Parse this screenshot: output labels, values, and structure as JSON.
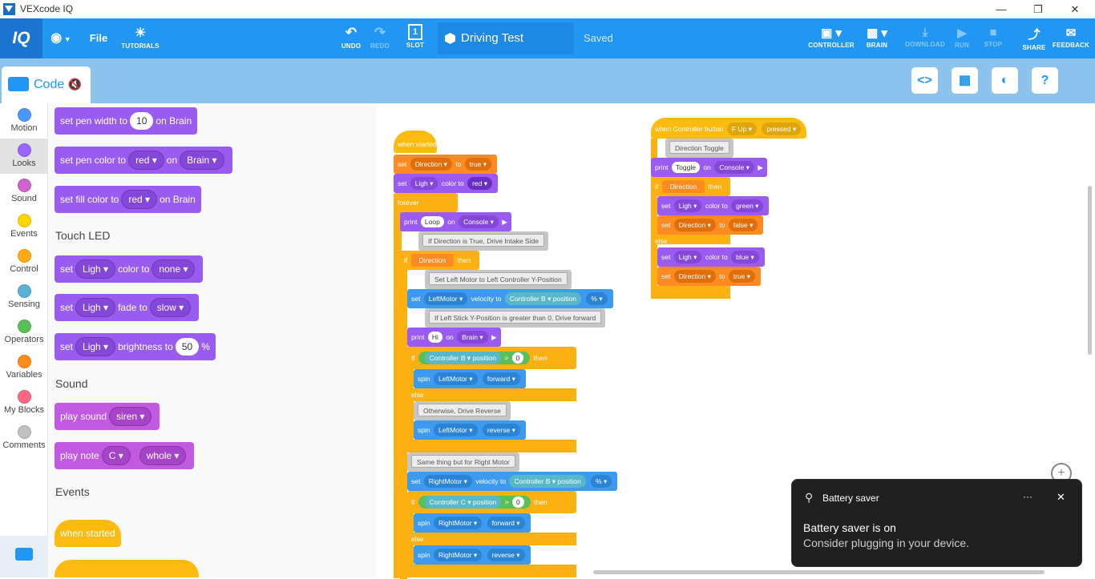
{
  "window": {
    "title": "VEXcode IQ",
    "min": "—",
    "max": "❐",
    "close": "✕"
  },
  "toolbar": {
    "logo": "IQ",
    "file": "File",
    "tutorials": "TUTORIALS",
    "undo": "UNDO",
    "redo": "REDO",
    "slot": "SLOT",
    "slot_num": "1",
    "project_name": "Driving Test",
    "status": "Saved",
    "controller": "CONTROLLER",
    "brain": "BRAIN",
    "download": "DOWNLOAD",
    "run": "RUN",
    "stop": "STOP",
    "share": "SHARE",
    "feedback": "FEEDBACK"
  },
  "code_tab": {
    "label": "Code"
  },
  "right_buttons": [
    "<>",
    "",
    "",
    "?"
  ],
  "categories": [
    {
      "label": "Motion",
      "color": "#4c97ff"
    },
    {
      "label": "Looks",
      "color": "#9966ff"
    },
    {
      "label": "Sound",
      "color": "#cf63cf"
    },
    {
      "label": "Events",
      "color": "#ffd500"
    },
    {
      "label": "Control",
      "color": "#ffab19"
    },
    {
      "label": "Sensing",
      "color": "#5cb1d6"
    },
    {
      "label": "Operators",
      "color": "#59c059"
    },
    {
      "label": "Variables",
      "color": "#ff8c1a"
    },
    {
      "label": "My Blocks",
      "color": "#ff6680"
    },
    {
      "label": "Comments",
      "color": "#c0c0c0"
    }
  ],
  "palette": {
    "pen_width": {
      "a": "set pen width to",
      "v": "10",
      "b": "on Brain"
    },
    "pen_color": {
      "a": "set pen color to",
      "v": "red",
      "b": "on",
      "c": "Brain"
    },
    "fill_color": {
      "a": "set fill color to",
      "v": "red",
      "b": "on Brain"
    },
    "touch_led_header": "Touch LED",
    "led_color": {
      "a": "set",
      "v": "Ligh",
      "b": "color to",
      "c": "none"
    },
    "led_fade": {
      "a": "set",
      "v": "Ligh",
      "b": "fade to",
      "c": "slow"
    },
    "led_bright": {
      "a": "set",
      "v": "Ligh",
      "b": "brightness to",
      "c": "50",
      "d": "%"
    },
    "sound_header": "Sound",
    "play_sound": {
      "a": "play sound",
      "v": "siren"
    },
    "play_note": {
      "a": "play note",
      "v": "C",
      "b": "whole"
    },
    "events_header": "Events",
    "when_started": "when started"
  },
  "ws": {
    "when_started": "when started",
    "set1": {
      "a": "set",
      "v": "Direction",
      "b": "to",
      "c": "true"
    },
    "set2": {
      "a": "set",
      "v": "Ligh",
      "b": "color to",
      "c": "red"
    },
    "forever": "forever",
    "print1": {
      "a": "print",
      "v": "Loop",
      "b": "on",
      "c": "Console"
    },
    "c1": "If Direction is True, Drive Intake Side",
    "if1": {
      "a": "if",
      "v": "Direction",
      "b": "then"
    },
    "c2": "Set Left Motor to Left Controller Y-Position",
    "setvel1": {
      "a": "set",
      "v": "LeftMotor",
      "b": "velocity to",
      "c": "Controller",
      "d": "B",
      "e": "position",
      "f": "%"
    },
    "c3": "If Left Stick Y-Position is greater than 0, Drive forward",
    "print2": {
      "a": "print",
      "v": "Hi",
      "b": "on",
      "c": "Brain"
    },
    "if2": {
      "a": "if",
      "v": "Controller",
      "b": "B",
      "c": "position",
      "d": ">",
      "e": "0",
      "f": "then"
    },
    "spin1": {
      "a": "spin",
      "v": "LeftMotor",
      "b": "forward"
    },
    "else1": "else",
    "c4": "Otherwise, Drive Reverse",
    "spin2": {
      "a": "spin",
      "v": "LeftMotor",
      "b": "reverse"
    },
    "c5": "Same thing but for Right Motor",
    "setvel2": {
      "a": "set",
      "v": "RightMotor",
      "b": "velocity to",
      "c": "Controller",
      "d": "B",
      "e": "position",
      "f": "%"
    },
    "if3": {
      "a": "if",
      "v": "Controller",
      "b": "C",
      "c": "position",
      "d": ">",
      "e": "0",
      "f": "then"
    },
    "spin3": {
      "a": "spin",
      "v": "RightMotor",
      "b": "forward"
    },
    "else2": "else",
    "spin4": {
      "a": "spin",
      "v": "RightMotor",
      "b": "reverse"
    },
    "when_btn": {
      "a": "when Controller button",
      "v": "F Up",
      "b": "pressed"
    },
    "c6": "Direction Toggle",
    "print3": {
      "a": "print",
      "v": "Toggle",
      "b": "on",
      "c": "Console"
    },
    "if4": {
      "a": "if",
      "v": "Direction",
      "b": "then"
    },
    "set3": {
      "a": "set",
      "v": "Ligh",
      "b": "color to",
      "c": "green"
    },
    "set4": {
      "a": "set",
      "v": "Direction",
      "b": "to",
      "c": "false"
    },
    "else3": "else",
    "set5": {
      "a": "set",
      "v": "Ligh",
      "b": "color to",
      "c": "blue"
    },
    "set6": {
      "a": "set",
      "v": "Direction",
      "b": "to",
      "c": "true"
    }
  },
  "toast": {
    "title": "Battery saver",
    "more": "···",
    "close": "✕",
    "headline": "Battery saver is on",
    "body": "Consider plugging in your device."
  }
}
